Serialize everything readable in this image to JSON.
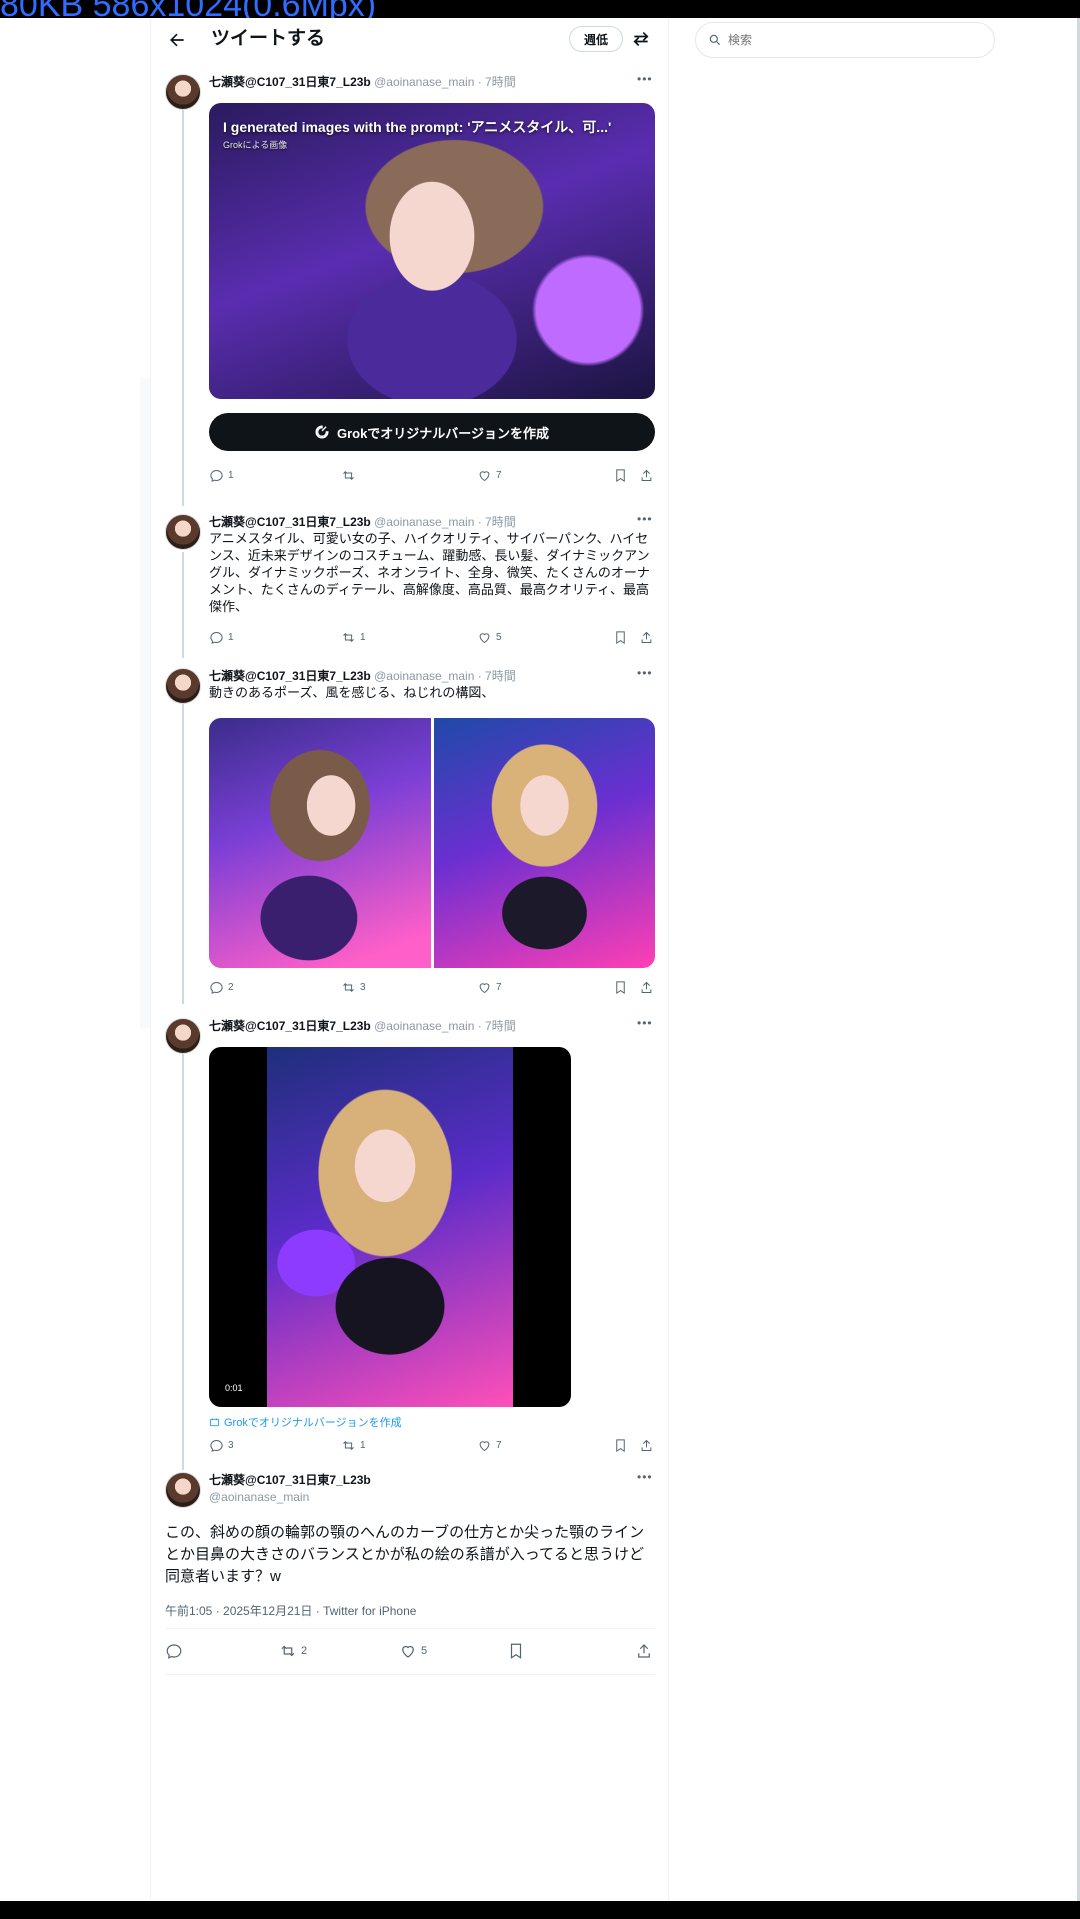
{
  "overlay_banner": "80KB 586x1024(0.6Mpx)",
  "header": {
    "title": "ツイートする",
    "tab_label": "週低"
  },
  "search": {
    "placeholder": "検索"
  },
  "tweets": [
    {
      "name": "七瀬葵@C107_31日東7_L23b",
      "handle": "@aoinanase_main · 7時間",
      "media_title": "I generated images with the prompt: 'アニメスタイル、可...'",
      "media_sub": "Grokによる画像",
      "grok_button": "Grokでオリジナルバージョンを作成",
      "actions": {
        "reply": "1",
        "retweet": "",
        "like": "7"
      }
    },
    {
      "name": "七瀬葵@C107_31日東7_L23b",
      "handle": "@aoinanase_main · 7時間",
      "text": "アニメスタイル、可愛い女の子、ハイクオリティ、サイバーパンク、ハイセンス、近未来デザインのコスチューム、躍動感、長い髪、ダイナミックアングル、ダイナミックポーズ、ネオンライト、全身、微笑、たくさんのオーナメント、たくさんのディテール、高解像度、高品質、最高クオリティ、最高傑作、",
      "actions": {
        "reply": "1",
        "retweet": "1",
        "like": "5"
      }
    },
    {
      "name": "七瀬葵@C107_31日東7_L23b",
      "handle": "@aoinanase_main · 7時間",
      "text": "動きのあるポーズ、風を感じる、ねじれの構図、",
      "actions": {
        "reply": "2",
        "retweet": "3",
        "like": "7"
      }
    },
    {
      "name": "七瀬葵@C107_31日東7_L23b",
      "handle": "@aoinanase_main · 7時間",
      "video_time": "0:01",
      "grok_link": "Grokでオリジナルバージョンを作成",
      "actions": {
        "reply": "3",
        "retweet": "1",
        "like": "7"
      }
    }
  ],
  "main_tweet": {
    "name": "七瀬葵@C107_31日東7_L23b",
    "handle": "@aoinanase_main",
    "text": "この、斜めの顔の輪郭の顎のへんのカーブの仕方とか尖った顎のラインとか目鼻の大きさのバランスとかが私の絵の系譜が入ってると思うけど同意者います？w",
    "timestamp": "午前1:05 · 2025年12月21日 · Twitter for iPhone",
    "actions": {
      "retweet": "2",
      "like": "5"
    }
  },
  "icons": [
    "back-arrow-icon",
    "swap-icon",
    "search-icon",
    "reply-icon",
    "retweet-icon",
    "like-icon",
    "bookmark-icon",
    "share-icon",
    "more-icon",
    "grok-icon"
  ],
  "colors": {
    "link": "#1d9bf0",
    "button_dark": "#0f1419",
    "muted": "#536471",
    "banner_text": "#2f6cff"
  }
}
